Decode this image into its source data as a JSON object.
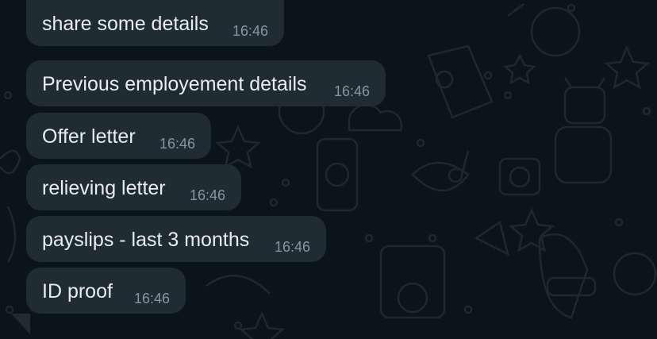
{
  "theme": {
    "background": "#0b141a",
    "bubble_incoming": "#202c33",
    "text_primary": "#e9edef",
    "text_meta": "#8696a0"
  },
  "messages": [
    {
      "text": "share some details",
      "time": "16:46"
    },
    {
      "text": "Previous employement details",
      "time": "16:46"
    },
    {
      "text": "Offer letter",
      "time": "16:46"
    },
    {
      "text": "relieving letter",
      "time": "16:46"
    },
    {
      "text": "payslips - last 3 months",
      "time": "16:46"
    },
    {
      "text": "ID proof",
      "time": "16:46"
    }
  ]
}
